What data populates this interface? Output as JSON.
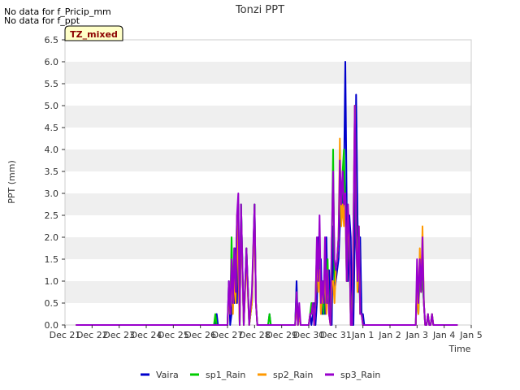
{
  "messages": [
    "No data for f_Pricip_mm",
    "No data for f_ppt"
  ],
  "chart_data": {
    "type": "line",
    "title": "Tonzi PPT",
    "xlabel": "Time",
    "ylabel": "PPT (mm)",
    "badge": "TZ_mixed",
    "ylim": [
      0,
      6.5
    ],
    "yticks": [
      "0.0",
      "0.5",
      "1.0",
      "1.5",
      "2.0",
      "2.5",
      "3.0",
      "3.5",
      "4.0",
      "4.5",
      "5.0",
      "5.5",
      "6.0",
      "6.5"
    ],
    "xlim": [
      0,
      15
    ],
    "xticks": [
      "Dec 21",
      "Dec 22",
      "Dec 23",
      "Dec 24",
      "Dec 25",
      "Dec 26",
      "Dec 27",
      "Dec 28",
      "Dec 29",
      "Dec 30",
      "Dec 31",
      "Jan 1",
      "Jan 2",
      "Jan 3",
      "Jan 4",
      "Jan 5"
    ],
    "grid": "horizontal-bands",
    "legend_position": "bottom",
    "series": [
      {
        "name": "Vaira",
        "color": "#0000cc",
        "x": [
          0.4,
          5.5,
          5.55,
          5.6,
          5.65,
          5.7,
          6.0,
          6.05,
          6.1,
          6.15,
          6.2,
          6.25,
          6.3,
          6.35,
          6.4,
          6.45,
          6.5,
          6.6,
          6.7,
          6.8,
          6.9,
          7.0,
          7.05,
          7.1,
          7.2,
          7.5,
          7.55,
          7.6,
          7.65,
          7.7,
          7.8,
          7.9,
          8.5,
          8.55,
          8.6,
          8.65,
          8.7,
          8.8,
          9.0,
          9.05,
          9.1,
          9.15,
          9.2,
          9.25,
          9.3,
          9.35,
          9.4,
          9.45,
          9.5,
          9.55,
          9.6,
          9.65,
          9.7,
          9.75,
          9.8,
          9.85,
          9.9,
          9.95,
          10.0,
          10.05,
          10.1,
          10.15,
          10.2,
          10.25,
          10.3,
          10.35,
          10.4,
          10.45,
          10.5,
          10.55,
          10.6,
          10.65,
          10.7,
          10.75,
          10.8,
          10.85,
          10.9,
          10.95,
          11.0,
          11.05,
          11.1,
          11.15,
          11.2,
          11.25,
          11.3,
          11.4,
          12.5,
          12.95,
          13.0,
          13.05,
          13.1,
          13.15,
          13.2,
          13.25,
          13.3,
          13.35,
          13.4,
          13.45,
          13.5,
          13.55,
          13.6,
          13.65,
          13.7,
          13.75,
          13.8,
          14.5
        ],
        "y": [
          0,
          0,
          0,
          0.25,
          0,
          0,
          0,
          1.0,
          0,
          0.25,
          0.75,
          0.5,
          1.75,
          0.5,
          2.5,
          0,
          2.75,
          0,
          1.75,
          0,
          0.5,
          2.75,
          0.5,
          0,
          0,
          0,
          0.25,
          0,
          0,
          0,
          0,
          0,
          0,
          1.0,
          0,
          0.25,
          0,
          0,
          0,
          0.25,
          0,
          0.25,
          0.5,
          0,
          0.5,
          2.0,
          1.0,
          1.5,
          0.25,
          1.0,
          0.25,
          2.0,
          0.5,
          1.25,
          0.25,
          0,
          2.25,
          0.75,
          1.0,
          1.25,
          1.5,
          2.25,
          3.25,
          2.5,
          3.25,
          6.0,
          2.75,
          1.0,
          2.5,
          2.0,
          0,
          0,
          2.0,
          5.25,
          2.5,
          0.75,
          2.0,
          0.25,
          0.25,
          0,
          0,
          0,
          0,
          0,
          0,
          0,
          0,
          0,
          1.0,
          0.25,
          1.5,
          1.0,
          1.25,
          0.5,
          0,
          0,
          0.25,
          0,
          0,
          0.25,
          0,
          0,
          0,
          0,
          0,
          0
        ],
        "smooth": false
      },
      {
        "name": "sp1_Rain",
        "color": "#00cc00",
        "x": [
          0.4,
          5.5,
          5.55,
          5.6,
          6.0,
          6.05,
          6.1,
          6.15,
          6.2,
          6.25,
          6.3,
          6.35,
          6.4,
          6.45,
          6.5,
          6.6,
          6.7,
          6.8,
          6.9,
          7.0,
          7.05,
          7.1,
          7.2,
          7.5,
          7.55,
          7.6,
          7.7,
          8.5,
          8.55,
          8.6,
          8.65,
          8.7,
          9.0,
          9.05,
          9.1,
          9.15,
          9.2,
          9.25,
          9.3,
          9.35,
          9.4,
          9.45,
          9.5,
          9.55,
          9.6,
          9.65,
          9.7,
          9.75,
          9.8,
          9.85,
          9.9,
          9.95,
          10.0,
          10.05,
          10.1,
          10.15,
          10.2,
          10.25,
          10.3,
          10.35,
          10.4,
          10.45,
          10.5,
          10.55,
          10.6,
          10.65,
          10.7,
          10.75,
          10.8,
          10.85,
          10.9,
          10.95,
          11.0,
          11.05,
          11.1,
          11.15,
          11.2,
          12.95,
          13.0,
          13.05,
          13.1,
          13.15,
          13.2,
          13.25,
          13.3,
          13.35,
          13.4,
          13.45,
          13.5,
          13.55,
          13.6,
          13.65,
          13.7,
          13.75,
          14.5
        ],
        "y": [
          0,
          0,
          0.25,
          0,
          0,
          0.75,
          0.25,
          2.0,
          0.5,
          1.75,
          0.75,
          2.5,
          1.5,
          0,
          2.75,
          0,
          1.75,
          0,
          0.5,
          2.75,
          0.5,
          0,
          0,
          0,
          0.25,
          0,
          0,
          0,
          0.75,
          0,
          0.25,
          0,
          0,
          0.25,
          0.5,
          0.5,
          0,
          0.5,
          1.75,
          1.0,
          1.5,
          0.25,
          1.0,
          0.25,
          1.5,
          0.5,
          1.5,
          0.25,
          0,
          1.75,
          4.0,
          1.0,
          1.25,
          1.5,
          2.0,
          3.25,
          2.5,
          3.5,
          4.0,
          2.75,
          1.0,
          2.5,
          2.0,
          0,
          0,
          1.75,
          5.0,
          2.5,
          0.75,
          1.75,
          0.25,
          0.25,
          0,
          0,
          0,
          0,
          0,
          0,
          1.0,
          0.25,
          1.25,
          0.75,
          1.0,
          0.5,
          0,
          0,
          0.25,
          0,
          0,
          0.25,
          0,
          0,
          0,
          0,
          0
        ],
        "smooth": false
      },
      {
        "name": "sp2_Rain",
        "color": "#ff9900",
        "x": [
          0.4,
          5.5,
          6.0,
          6.05,
          6.1,
          6.15,
          6.2,
          6.25,
          6.3,
          6.35,
          6.4,
          6.45,
          6.5,
          6.6,
          6.7,
          6.8,
          6.9,
          7.0,
          7.05,
          7.1,
          7.2,
          8.5,
          8.55,
          8.6,
          8.65,
          8.7,
          9.0,
          9.05,
          9.1,
          9.15,
          9.2,
          9.25,
          9.3,
          9.35,
          9.4,
          9.45,
          9.5,
          9.55,
          9.6,
          9.65,
          9.7,
          9.75,
          9.8,
          9.85,
          9.9,
          9.95,
          10.0,
          10.05,
          10.1,
          10.15,
          10.2,
          10.25,
          10.3,
          10.35,
          10.4,
          10.45,
          10.5,
          10.55,
          10.6,
          10.65,
          10.7,
          10.75,
          10.8,
          10.85,
          10.9,
          10.95,
          11.0,
          11.05,
          11.1,
          11.15,
          11.2,
          12.95,
          13.0,
          13.05,
          13.1,
          13.15,
          13.2,
          13.25,
          13.3,
          13.35,
          13.4,
          13.45,
          13.5,
          13.55,
          13.6,
          13.65,
          13.7,
          13.75,
          14.5
        ],
        "y": [
          0,
          0,
          0,
          0.75,
          0.25,
          1.5,
          0.25,
          1.25,
          0.5,
          2.5,
          1.25,
          0,
          2.5,
          0,
          1.5,
          0,
          0.5,
          2.5,
          0.5,
          0,
          0,
          0,
          0.5,
          0,
          0.25,
          0,
          0,
          0.25,
          0.25,
          0.5,
          0,
          0.5,
          1.75,
          0.75,
          1.25,
          0.25,
          0.75,
          0.5,
          1.25,
          0.25,
          1.25,
          0.25,
          0,
          1.0,
          1.0,
          0.5,
          1.25,
          1.5,
          2.0,
          4.25,
          2.25,
          2.75,
          2.25,
          3.0,
          1.0,
          2.25,
          2.0,
          0,
          0,
          2.25,
          5.0,
          2.25,
          0.75,
          2.25,
          0.25,
          0.25,
          0,
          0,
          0,
          0,
          0,
          0,
          1.0,
          0.25,
          1.75,
          0.75,
          2.25,
          0.5,
          0,
          0,
          0.25,
          0,
          0,
          0.25,
          0,
          0,
          0,
          0,
          0
        ],
        "smooth": false
      },
      {
        "name": "sp3_Rain",
        "color": "#9900cc",
        "x": [
          0.4,
          5.5,
          6.0,
          6.05,
          6.1,
          6.15,
          6.2,
          6.25,
          6.3,
          6.35,
          6.4,
          6.45,
          6.5,
          6.6,
          6.7,
          6.8,
          6.9,
          7.0,
          7.05,
          7.1,
          7.2,
          8.5,
          8.55,
          8.6,
          8.65,
          8.7,
          9.0,
          9.05,
          9.1,
          9.15,
          9.2,
          9.25,
          9.3,
          9.35,
          9.4,
          9.45,
          9.5,
          9.55,
          9.6,
          9.65,
          9.7,
          9.75,
          9.8,
          9.85,
          9.9,
          9.95,
          10.0,
          10.05,
          10.1,
          10.15,
          10.2,
          10.25,
          10.3,
          10.35,
          10.4,
          10.45,
          10.5,
          10.55,
          10.6,
          10.65,
          10.7,
          10.75,
          10.8,
          10.85,
          10.9,
          10.95,
          11.0,
          11.05,
          11.1,
          11.15,
          11.2,
          12.95,
          13.0,
          13.05,
          13.1,
          13.15,
          13.2,
          13.25,
          13.3,
          13.35,
          13.4,
          13.45,
          13.5,
          13.55,
          13.6,
          13.65,
          13.7,
          13.75,
          14.5
        ],
        "y": [
          0,
          0,
          0,
          1.0,
          0.25,
          1.5,
          0.5,
          1.75,
          0.75,
          2.5,
          3.0,
          0,
          2.75,
          0,
          1.75,
          0,
          0.75,
          2.75,
          0.5,
          0,
          0,
          0,
          0.75,
          0,
          0.5,
          0,
          0,
          0.25,
          0.25,
          0.5,
          0,
          0.5,
          2.0,
          1.0,
          2.5,
          0.5,
          1.0,
          0.5,
          2.0,
          0.5,
          1.25,
          0.25,
          0,
          2.0,
          3.5,
          1.5,
          1.25,
          1.5,
          2.0,
          3.75,
          2.75,
          3.5,
          2.75,
          3.0,
          1.0,
          2.75,
          2.0,
          0,
          0,
          2.25,
          5.0,
          2.0,
          1.0,
          2.25,
          0.25,
          0.25,
          0,
          0,
          0,
          0,
          0,
          0,
          1.5,
          0.5,
          1.5,
          0.75,
          2.0,
          0.5,
          0,
          0,
          0.25,
          0,
          0,
          0.25,
          0,
          0,
          0,
          0,
          0
        ],
        "smooth": false
      }
    ]
  }
}
